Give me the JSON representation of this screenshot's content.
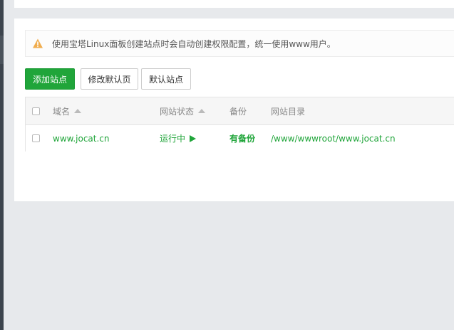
{
  "notice": {
    "text": "使用宝塔Linux面板创建站点时会自动创建权限配置，统一使用www用户。",
    "icon": "warning-triangle-icon"
  },
  "toolbar": {
    "add_site_label": "添加站点",
    "modify_default_page_label": "修改默认页",
    "default_site_label": "默认站点"
  },
  "table": {
    "columns": {
      "domain": "域名",
      "status": "网站状态",
      "backup": "备份",
      "directory": "网站目录"
    },
    "rows": [
      {
        "domain": "www.jocat.cn",
        "status": "运行中",
        "backup": "有备份",
        "directory": "/www/wwwroot/www.jocat.cn"
      }
    ]
  },
  "colors": {
    "accent": "#20a53a",
    "warning": "#f0ad4e",
    "page_bg": "#e7e9ec"
  }
}
